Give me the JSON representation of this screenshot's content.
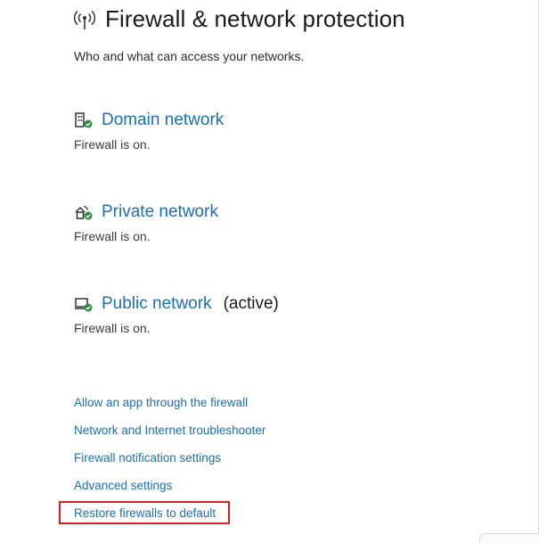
{
  "header": {
    "title": "Firewall & network protection",
    "icon": "antenna-icon",
    "subtitle": "Who and what can access your networks."
  },
  "networks": [
    {
      "name": "Domain network",
      "status": "Firewall is on.",
      "active_label": "",
      "icon": "domain-network-icon"
    },
    {
      "name": "Private network",
      "status": "Firewall is on.",
      "active_label": "",
      "icon": "private-network-icon"
    },
    {
      "name": "Public network",
      "status": "Firewall is on.",
      "active_label": "(active)",
      "icon": "public-network-icon"
    }
  ],
  "links": [
    "Allow an app through the firewall",
    "Network and Internet troubleshooter",
    "Firewall notification settings",
    "Advanced settings",
    "Restore firewalls to default"
  ],
  "colors": {
    "link": "#1a6fb5",
    "status_ok": "#2e8b3a",
    "highlight": "#d61f26"
  }
}
